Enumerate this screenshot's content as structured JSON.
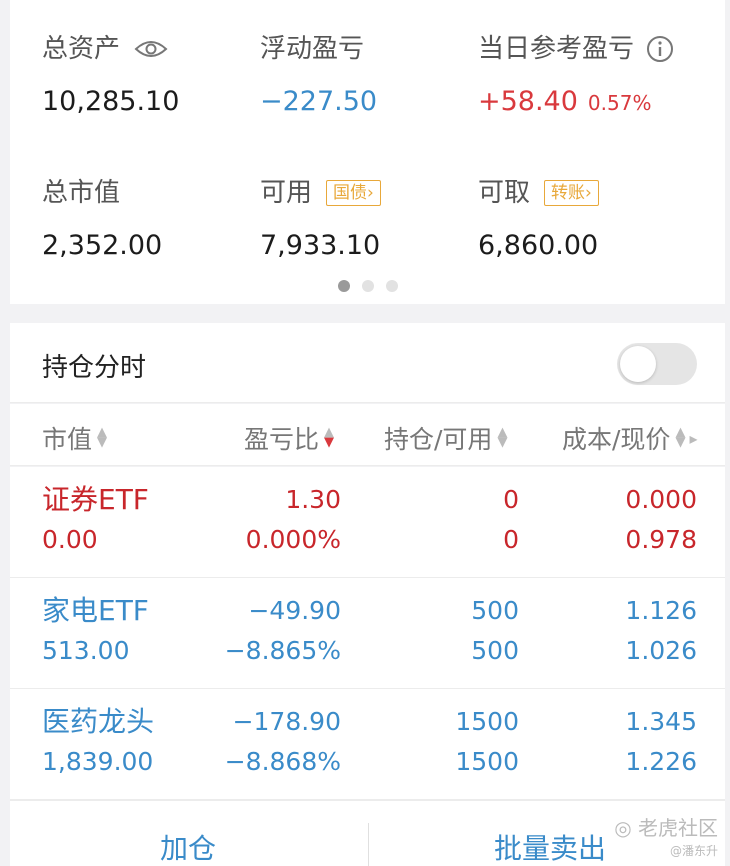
{
  "summary": {
    "total_assets": {
      "label": "总资产",
      "value": "10,285.10"
    },
    "floating_pl": {
      "label": "浮动盈亏",
      "value": "−227.50"
    },
    "daily_pl": {
      "label": "当日参考盈亏",
      "value": "+58.40",
      "pct": "0.57%"
    },
    "market_value": {
      "label": "总市值",
      "value": "2,352.00"
    },
    "available": {
      "label": "可用",
      "value": "7,933.10",
      "tag": "国债"
    },
    "withdrawable": {
      "label": "可取",
      "value": "6,860.00",
      "tag": "转账"
    }
  },
  "holdings": {
    "title": "持仓分时",
    "toggle_on": false
  },
  "table": {
    "headers": [
      "市值",
      "盈亏比",
      "持仓/可用",
      "成本/现价"
    ],
    "rows": [
      {
        "name": "证券ETF",
        "mv": "0.00",
        "pl": "1.30",
        "pl_pct": "0.000%",
        "pos": "0",
        "avail": "0",
        "cost": "0.000",
        "price": "0.978",
        "color": "red"
      },
      {
        "name": "家电ETF",
        "mv": "513.00",
        "pl": "−49.90",
        "pl_pct": "−8.865%",
        "pos": "500",
        "avail": "500",
        "cost": "1.126",
        "price": "1.026",
        "color": "blue"
      },
      {
        "name": "医药龙头",
        "mv": "1,839.00",
        "pl": "−178.90",
        "pl_pct": "−8.868%",
        "pos": "1500",
        "avail": "1500",
        "cost": "1.345",
        "price": "1.226",
        "color": "blue"
      }
    ]
  },
  "actions": {
    "add": "加仓",
    "batch_sell": "批量卖出"
  },
  "watermark": {
    "text": "老虎社区",
    "author": "@潘东升"
  },
  "colors": {
    "red": "#c8262b",
    "blue": "#3a8bc9",
    "orange": "#e8a83a"
  }
}
